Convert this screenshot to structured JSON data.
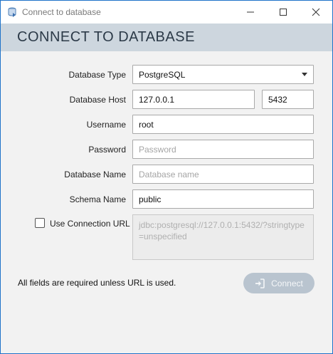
{
  "window": {
    "title": "Connect to database"
  },
  "header": {
    "title": "CONNECT TO DATABASE"
  },
  "form": {
    "database_type": {
      "label": "Database Type",
      "value": "PostgreSQL"
    },
    "database_host": {
      "label": "Database Host",
      "host": "127.0.0.1",
      "port": "5432"
    },
    "username": {
      "label": "Username",
      "value": "root"
    },
    "password": {
      "label": "Password",
      "placeholder": "Password"
    },
    "database_name": {
      "label": "Database Name",
      "placeholder": "Database name"
    },
    "schema_name": {
      "label": "Schema Name",
      "value": "public"
    },
    "use_connection_url": {
      "label": "Use Connection URL",
      "checked": false,
      "placeholder": "jdbc:postgresql://127.0.0.1:5432/?stringtype=unspecified"
    }
  },
  "footer": {
    "note": "All fields are required unless URL is used.",
    "connect_label": "Connect"
  },
  "icons": {
    "app": "database-connect-icon",
    "minimize": "minimize-icon",
    "maximize": "maximize-icon",
    "close": "close-icon",
    "dropdown": "chevron-down-icon",
    "connect": "sign-in-icon"
  }
}
